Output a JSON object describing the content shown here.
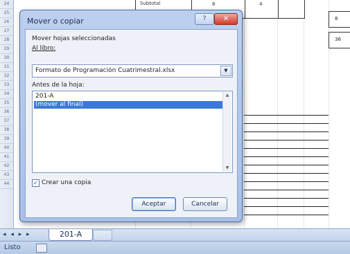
{
  "sheet": {
    "row_numbers": [
      "24",
      "25",
      "26",
      "27",
      "28",
      "29",
      "30",
      "31",
      "32",
      "33",
      "34",
      "35",
      "36",
      "37",
      "38",
      "39",
      "40",
      "41",
      "42",
      "43",
      "44"
    ],
    "top_cells": [
      "Subtotal",
      "8",
      "4",
      "8"
    ],
    "right_cells": [
      "8",
      "36"
    ]
  },
  "dialog": {
    "title": "Mover o copiar",
    "help_label": "?",
    "close_label": "✕",
    "subtitle": "Mover hojas seleccionadas",
    "book_label": "Al libro:",
    "book_value": "Formato de Programación Cuatrimestral.xlsx",
    "before_label": "Antes de la hoja:",
    "sheets": [
      "201-A",
      "(mover al final)"
    ],
    "selected_index": 1,
    "copy_checked": true,
    "copy_label": "Crear una copia",
    "ok_label": "Aceptar",
    "cancel_label": "Cancelar"
  },
  "tabs": {
    "nav_label": "◂ ◂ ▸ ▸",
    "active": "201-A"
  },
  "status": {
    "text": "Listo"
  }
}
